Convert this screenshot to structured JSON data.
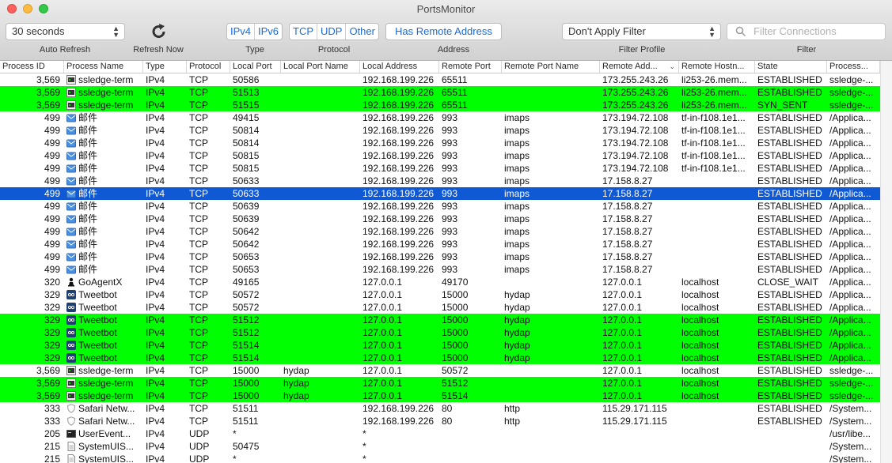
{
  "window": {
    "title": "PortsMonitor"
  },
  "toolbar": {
    "auto_refresh": {
      "value": "30 seconds",
      "label": "Auto Refresh"
    },
    "refresh_now": {
      "label": "Refresh Now"
    },
    "type": {
      "options": [
        "IPv4",
        "IPv6"
      ],
      "label": "Type"
    },
    "protocol": {
      "options": [
        "TCP",
        "UDP",
        "Other"
      ],
      "label": "Protocol"
    },
    "address": {
      "button": "Has Remote Address",
      "label": "Address"
    },
    "filter_profile": {
      "value": "Don't Apply Filter",
      "label": "Filter Profile"
    },
    "filter": {
      "placeholder": "Filter Connections",
      "label": "Filter"
    }
  },
  "columns": [
    "Process ID",
    "Process Name",
    "Type",
    "Protocol",
    "Local Port",
    "Local Port Name",
    "Local Address",
    "Remote Port",
    "Remote Port Name",
    "Remote Add...",
    "Remote Hostn...",
    "State",
    "Process..."
  ],
  "colors": {
    "highlight": "#00ff00",
    "selection": "#1059d5"
  },
  "rows": [
    {
      "pid": "3,569",
      "icon": "terminal-icon",
      "name": "ssledge-term",
      "type": "IPv4",
      "proto": "TCP",
      "lport": "50586",
      "lpname": "",
      "laddr": "192.168.199.226",
      "rport": "65511",
      "rpname": "",
      "raddr": "173.255.243.26",
      "rhost": "li253-26.mem...",
      "state": "ESTABLISHED",
      "path": "ssledge-...",
      "hl": ""
    },
    {
      "pid": "3,569",
      "icon": "terminal-icon",
      "name": "ssledge-term",
      "type": "IPv4",
      "proto": "TCP",
      "lport": "51513",
      "lpname": "",
      "laddr": "192.168.199.226",
      "rport": "65511",
      "rpname": "",
      "raddr": "173.255.243.26",
      "rhost": "li253-26.mem...",
      "state": "ESTABLISHED",
      "path": "ssledge-...",
      "hl": "green"
    },
    {
      "pid": "3,569",
      "icon": "terminal-icon",
      "name": "ssledge-term",
      "type": "IPv4",
      "proto": "TCP",
      "lport": "51515",
      "lpname": "",
      "laddr": "192.168.199.226",
      "rport": "65511",
      "rpname": "",
      "raddr": "173.255.243.26",
      "rhost": "li253-26.mem...",
      "state": "SYN_SENT",
      "path": "ssledge-...",
      "hl": "green"
    },
    {
      "pid": "499",
      "icon": "mail-icon",
      "name": "邮件",
      "type": "IPv4",
      "proto": "TCP",
      "lport": "49415",
      "lpname": "",
      "laddr": "192.168.199.226",
      "rport": "993",
      "rpname": "imaps",
      "raddr": "173.194.72.108",
      "rhost": "tf-in-f108.1e1...",
      "state": "ESTABLISHED",
      "path": "/Applica...",
      "hl": ""
    },
    {
      "pid": "499",
      "icon": "mail-icon",
      "name": "邮件",
      "type": "IPv4",
      "proto": "TCP",
      "lport": "50814",
      "lpname": "",
      "laddr": "192.168.199.226",
      "rport": "993",
      "rpname": "imaps",
      "raddr": "173.194.72.108",
      "rhost": "tf-in-f108.1e1...",
      "state": "ESTABLISHED",
      "path": "/Applica...",
      "hl": ""
    },
    {
      "pid": "499",
      "icon": "mail-icon",
      "name": "邮件",
      "type": "IPv4",
      "proto": "TCP",
      "lport": "50814",
      "lpname": "",
      "laddr": "192.168.199.226",
      "rport": "993",
      "rpname": "imaps",
      "raddr": "173.194.72.108",
      "rhost": "tf-in-f108.1e1...",
      "state": "ESTABLISHED",
      "path": "/Applica...",
      "hl": ""
    },
    {
      "pid": "499",
      "icon": "mail-icon",
      "name": "邮件",
      "type": "IPv4",
      "proto": "TCP",
      "lport": "50815",
      "lpname": "",
      "laddr": "192.168.199.226",
      "rport": "993",
      "rpname": "imaps",
      "raddr": "173.194.72.108",
      "rhost": "tf-in-f108.1e1...",
      "state": "ESTABLISHED",
      "path": "/Applica...",
      "hl": ""
    },
    {
      "pid": "499",
      "icon": "mail-icon",
      "name": "邮件",
      "type": "IPv4",
      "proto": "TCP",
      "lport": "50815",
      "lpname": "",
      "laddr": "192.168.199.226",
      "rport": "993",
      "rpname": "imaps",
      "raddr": "173.194.72.108",
      "rhost": "tf-in-f108.1e1...",
      "state": "ESTABLISHED",
      "path": "/Applica...",
      "hl": ""
    },
    {
      "pid": "499",
      "icon": "mail-icon",
      "name": "邮件",
      "type": "IPv4",
      "proto": "TCP",
      "lport": "50633",
      "lpname": "",
      "laddr": "192.168.199.226",
      "rport": "993",
      "rpname": "imaps",
      "raddr": "17.158.8.27",
      "rhost": "",
      "state": "ESTABLISHED",
      "path": "/Applica...",
      "hl": ""
    },
    {
      "pid": "499",
      "icon": "mail-icon",
      "name": "邮件",
      "type": "IPv4",
      "proto": "TCP",
      "lport": "50633",
      "lpname": "",
      "laddr": "192.168.199.226",
      "rport": "993",
      "rpname": "imaps",
      "raddr": "17.158.8.27",
      "rhost": "",
      "state": "ESTABLISHED",
      "path": "/Applica...",
      "hl": "selected"
    },
    {
      "pid": "499",
      "icon": "mail-icon",
      "name": "邮件",
      "type": "IPv4",
      "proto": "TCP",
      "lport": "50639",
      "lpname": "",
      "laddr": "192.168.199.226",
      "rport": "993",
      "rpname": "imaps",
      "raddr": "17.158.8.27",
      "rhost": "",
      "state": "ESTABLISHED",
      "path": "/Applica...",
      "hl": ""
    },
    {
      "pid": "499",
      "icon": "mail-icon",
      "name": "邮件",
      "type": "IPv4",
      "proto": "TCP",
      "lport": "50639",
      "lpname": "",
      "laddr": "192.168.199.226",
      "rport": "993",
      "rpname": "imaps",
      "raddr": "17.158.8.27",
      "rhost": "",
      "state": "ESTABLISHED",
      "path": "/Applica...",
      "hl": ""
    },
    {
      "pid": "499",
      "icon": "mail-icon",
      "name": "邮件",
      "type": "IPv4",
      "proto": "TCP",
      "lport": "50642",
      "lpname": "",
      "laddr": "192.168.199.226",
      "rport": "993",
      "rpname": "imaps",
      "raddr": "17.158.8.27",
      "rhost": "",
      "state": "ESTABLISHED",
      "path": "/Applica...",
      "hl": ""
    },
    {
      "pid": "499",
      "icon": "mail-icon",
      "name": "邮件",
      "type": "IPv4",
      "proto": "TCP",
      "lport": "50642",
      "lpname": "",
      "laddr": "192.168.199.226",
      "rport": "993",
      "rpname": "imaps",
      "raddr": "17.158.8.27",
      "rhost": "",
      "state": "ESTABLISHED",
      "path": "/Applica...",
      "hl": ""
    },
    {
      "pid": "499",
      "icon": "mail-icon",
      "name": "邮件",
      "type": "IPv4",
      "proto": "TCP",
      "lport": "50653",
      "lpname": "",
      "laddr": "192.168.199.226",
      "rport": "993",
      "rpname": "imaps",
      "raddr": "17.158.8.27",
      "rhost": "",
      "state": "ESTABLISHED",
      "path": "/Applica...",
      "hl": ""
    },
    {
      "pid": "499",
      "icon": "mail-icon",
      "name": "邮件",
      "type": "IPv4",
      "proto": "TCP",
      "lport": "50653",
      "lpname": "",
      "laddr": "192.168.199.226",
      "rport": "993",
      "rpname": "imaps",
      "raddr": "17.158.8.27",
      "rhost": "",
      "state": "ESTABLISHED",
      "path": "/Applica...",
      "hl": ""
    },
    {
      "pid": "320",
      "icon": "chess-pawn-icon",
      "name": "GoAgentX",
      "type": "IPv4",
      "proto": "TCP",
      "lport": "49165",
      "lpname": "",
      "laddr": "127.0.0.1",
      "rport": "49170",
      "rpname": "",
      "raddr": "127.0.0.1",
      "rhost": "localhost",
      "state": "CLOSE_WAIT",
      "path": "/Applica...",
      "hl": ""
    },
    {
      "pid": "329",
      "icon": "bird-icon",
      "name": "Tweetbot",
      "type": "IPv4",
      "proto": "TCP",
      "lport": "50572",
      "lpname": "",
      "laddr": "127.0.0.1",
      "rport": "15000",
      "rpname": "hydap",
      "raddr": "127.0.0.1",
      "rhost": "localhost",
      "state": "ESTABLISHED",
      "path": "/Applica...",
      "hl": ""
    },
    {
      "pid": "329",
      "icon": "bird-icon",
      "name": "Tweetbot",
      "type": "IPv4",
      "proto": "TCP",
      "lport": "50572",
      "lpname": "",
      "laddr": "127.0.0.1",
      "rport": "15000",
      "rpname": "hydap",
      "raddr": "127.0.0.1",
      "rhost": "localhost",
      "state": "ESTABLISHED",
      "path": "/Applica...",
      "hl": ""
    },
    {
      "pid": "329",
      "icon": "bird-icon",
      "name": "Tweetbot",
      "type": "IPv4",
      "proto": "TCP",
      "lport": "51512",
      "lpname": "",
      "laddr": "127.0.0.1",
      "rport": "15000",
      "rpname": "hydap",
      "raddr": "127.0.0.1",
      "rhost": "localhost",
      "state": "ESTABLISHED",
      "path": "/Applica...",
      "hl": "green"
    },
    {
      "pid": "329",
      "icon": "bird-icon",
      "name": "Tweetbot",
      "type": "IPv4",
      "proto": "TCP",
      "lport": "51512",
      "lpname": "",
      "laddr": "127.0.0.1",
      "rport": "15000",
      "rpname": "hydap",
      "raddr": "127.0.0.1",
      "rhost": "localhost",
      "state": "ESTABLISHED",
      "path": "/Applica...",
      "hl": "green"
    },
    {
      "pid": "329",
      "icon": "bird-icon",
      "name": "Tweetbot",
      "type": "IPv4",
      "proto": "TCP",
      "lport": "51514",
      "lpname": "",
      "laddr": "127.0.0.1",
      "rport": "15000",
      "rpname": "hydap",
      "raddr": "127.0.0.1",
      "rhost": "localhost",
      "state": "ESTABLISHED",
      "path": "/Applica...",
      "hl": "green"
    },
    {
      "pid": "329",
      "icon": "bird-icon",
      "name": "Tweetbot",
      "type": "IPv4",
      "proto": "TCP",
      "lport": "51514",
      "lpname": "",
      "laddr": "127.0.0.1",
      "rport": "15000",
      "rpname": "hydap",
      "raddr": "127.0.0.1",
      "rhost": "localhost",
      "state": "ESTABLISHED",
      "path": "/Applica...",
      "hl": "green"
    },
    {
      "pid": "3,569",
      "icon": "terminal-icon",
      "name": "ssledge-term",
      "type": "IPv4",
      "proto": "TCP",
      "lport": "15000",
      "lpname": "hydap",
      "laddr": "127.0.0.1",
      "rport": "50572",
      "rpname": "",
      "raddr": "127.0.0.1",
      "rhost": "localhost",
      "state": "ESTABLISHED",
      "path": "ssledge-...",
      "hl": ""
    },
    {
      "pid": "3,569",
      "icon": "terminal-icon",
      "name": "ssledge-term",
      "type": "IPv4",
      "proto": "TCP",
      "lport": "15000",
      "lpname": "hydap",
      "laddr": "127.0.0.1",
      "rport": "51512",
      "rpname": "",
      "raddr": "127.0.0.1",
      "rhost": "localhost",
      "state": "ESTABLISHED",
      "path": "ssledge-...",
      "hl": "green"
    },
    {
      "pid": "3,569",
      "icon": "terminal-icon",
      "name": "ssledge-term",
      "type": "IPv4",
      "proto": "TCP",
      "lport": "15000",
      "lpname": "hydap",
      "laddr": "127.0.0.1",
      "rport": "51514",
      "rpname": "",
      "raddr": "127.0.0.1",
      "rhost": "localhost",
      "state": "ESTABLISHED",
      "path": "ssledge-...",
      "hl": "green"
    },
    {
      "pid": "333",
      "icon": "shield-icon",
      "name": "Safari Netw...",
      "type": "IPv4",
      "proto": "TCP",
      "lport": "51511",
      "lpname": "",
      "laddr": "192.168.199.226",
      "rport": "80",
      "rpname": "http",
      "raddr": "115.29.171.115",
      "rhost": "",
      "state": "ESTABLISHED",
      "path": "/System...",
      "hl": ""
    },
    {
      "pid": "333",
      "icon": "shield-icon",
      "name": "Safari Netw...",
      "type": "IPv4",
      "proto": "TCP",
      "lport": "51511",
      "lpname": "",
      "laddr": "192.168.199.226",
      "rport": "80",
      "rpname": "http",
      "raddr": "115.29.171.115",
      "rhost": "",
      "state": "ESTABLISHED",
      "path": "/System...",
      "hl": ""
    },
    {
      "pid": "205",
      "icon": "console-icon",
      "name": "UserEvent...",
      "type": "IPv4",
      "proto": "UDP",
      "lport": "*",
      "lpname": "",
      "laddr": "*",
      "rport": "",
      "rpname": "",
      "raddr": "",
      "rhost": "",
      "state": "",
      "path": "/usr/libe...",
      "hl": ""
    },
    {
      "pid": "215",
      "icon": "document-icon",
      "name": "SystemUIS...",
      "type": "IPv4",
      "proto": "UDP",
      "lport": "50475",
      "lpname": "",
      "laddr": "*",
      "rport": "",
      "rpname": "",
      "raddr": "",
      "rhost": "",
      "state": "",
      "path": "/System...",
      "hl": ""
    },
    {
      "pid": "215",
      "icon": "document-icon",
      "name": "SystemUIS...",
      "type": "IPv4",
      "proto": "UDP",
      "lport": "*",
      "lpname": "",
      "laddr": "*",
      "rport": "",
      "rpname": "",
      "raddr": "",
      "rhost": "",
      "state": "",
      "path": "/System...",
      "hl": ""
    }
  ]
}
